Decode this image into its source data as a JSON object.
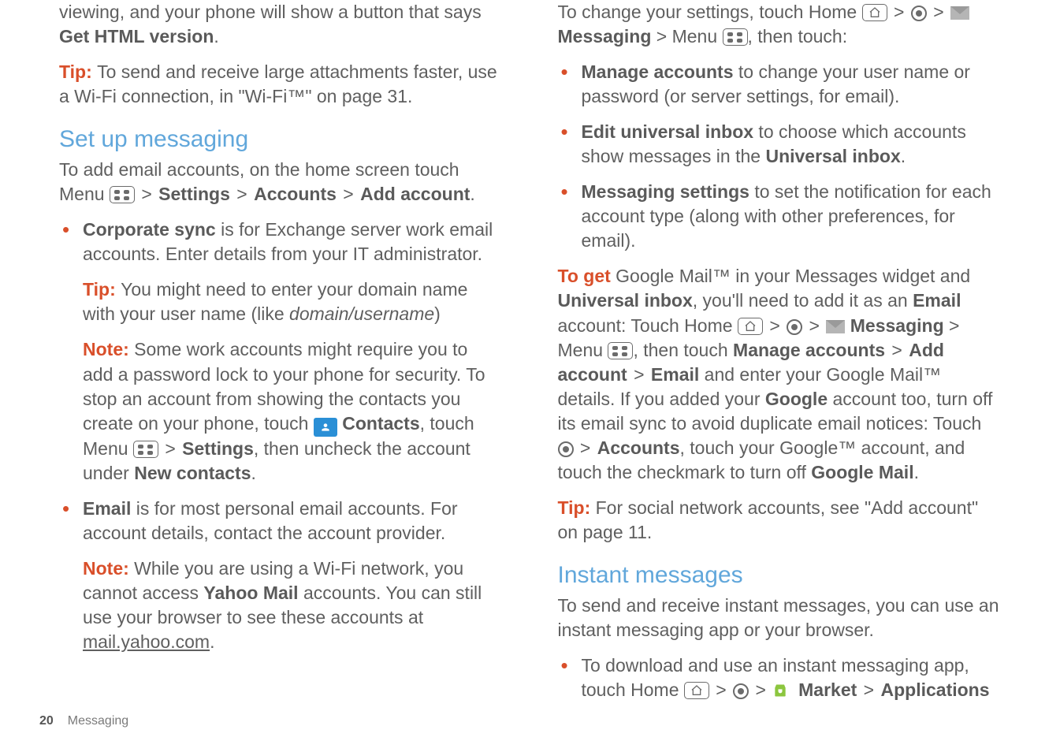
{
  "left": {
    "intro1": "viewing, and your phone will show a button that says ",
    "intro1b": "Get HTML version",
    "intro1c": ".",
    "tip1_label": "Tip: ",
    "tip1_text": "To send and receive large attachments faster, use a Wi-Fi connection, in \"Wi-Fi™\" on page 31.",
    "h2": "Set up messaging",
    "lead1a": "To add email accounts, on the home screen touch Menu ",
    "lead1b": "Settings",
    "lead1c": "Accounts",
    "lead1d": "Add account",
    "lead1e": ".",
    "li1a": "Corporate sync",
    "li1b": " is for Exchange server work email accounts. Enter details from your IT administrator.",
    "li1_tip_label": "Tip: ",
    "li1_tip_text": "You might need to enter your domain name with your user name (like ",
    "li1_tip_italic": "domain/username",
    "li1_tip_end": ")",
    "li1_note_label": "Note: ",
    "li1_note_text": "Some work accounts might require you to add a password lock to your phone for security. To stop an account from showing the contacts you create on your phone, touch ",
    "li1_note_contacts": "Contacts",
    "li1_note_after_contacts": ", touch Menu ",
    "li1_note_settings": "Settings",
    "li1_note_tail": ", then uncheck the account under ",
    "li1_note_newcontacts": "New contacts",
    "li1_note_period": ".",
    "li2a": "Email",
    "li2b": " is for most personal email accounts. For account details, contact the account provider.",
    "li2_note_label": "Note: ",
    "li2_note_text": "While you are using a Wi-Fi network, you cannot access ",
    "li2_note_yahoo": "Yahoo Mail",
    "li2_note_tail": " accounts. You can still use your browser to see these accounts at ",
    "li2_note_link": "mail.yahoo.com",
    "li2_note_period": "."
  },
  "right": {
    "lead1": "To change your settings, touch Home ",
    "lead2": "Messaging",
    "lead3": " > Menu ",
    "lead4": ", then touch:",
    "li1a": "Manage accounts",
    "li1b": " to change your user name or password (or server settings, for email).",
    "li2a": "Edit universal inbox",
    "li2b": " to choose which accounts show messages in the ",
    "li2c": "Universal inbox",
    "li2d": ".",
    "li3a": "Messaging settings",
    "li3b": " to set the notification for each account type (along with other preferences, for email).",
    "p2_label": "To get ",
    "p2a": "Google Mail™ in your Messages widget and ",
    "p2_uinbox": "Universal inbox",
    "p2b": ", you'll need to add it as an ",
    "p2_email": "Email",
    "p2c": " account: Touch Home ",
    "p2_msg": "Messaging",
    "p2d": " > Menu ",
    "p2e": ", then touch ",
    "p2_manage": "Manage accounts",
    "p2_add": "Add account",
    "p2_emailb": "Email",
    "p2f": " and enter your Google Mail™ details. If you added your ",
    "p2_google": "Google",
    "p2g": " account too, turn off its email sync to avoid duplicate email notices: Touch ",
    "p2_accounts": "Accounts",
    "p2h": ", touch your Google™ account, and touch the checkmark to turn off ",
    "p2_gmail": "Google Mail",
    "p2i": ".",
    "tip2_label": "Tip: ",
    "tip2_text": "For social network accounts, see \"Add account\" on page 11.",
    "h2": "Instant messages",
    "im1": "To send and receive instant messages, you can use an instant messaging app or your browser.",
    "im_li1a": "To download and use an instant messaging app, touch Home ",
    "im_li1_market": "Market",
    "im_li1_apps": "Applications"
  },
  "footer": {
    "page": "20",
    "section": "Messaging"
  },
  "glyphs": {
    "gt": ">"
  }
}
